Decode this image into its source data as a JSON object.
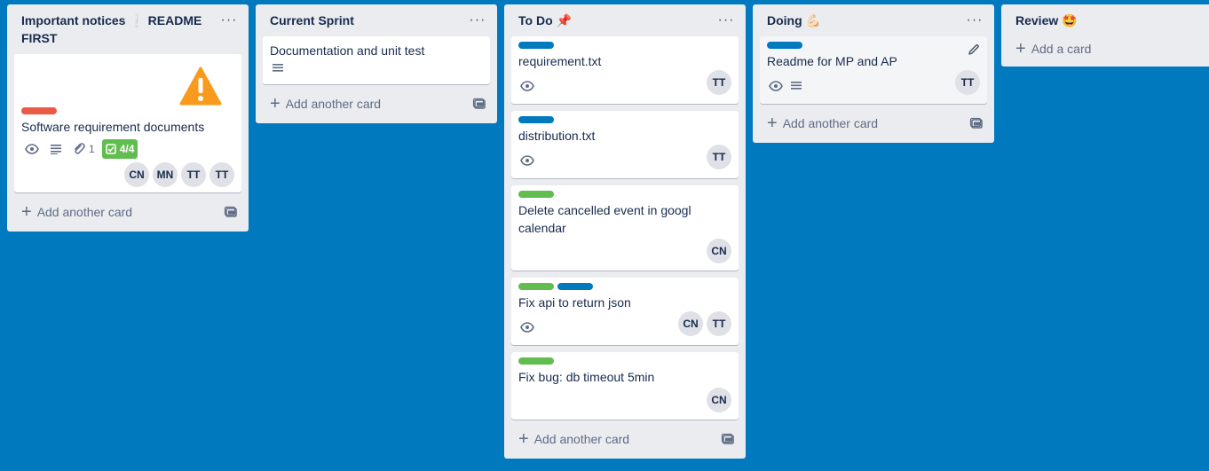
{
  "lists": [
    {
      "title": "Important notices ❕ README FIRST",
      "menu": "···",
      "add_label": "Add another card",
      "cards": [
        {
          "title": "Software requirement documents",
          "image_icon": "warning-icon",
          "labels": [
            "#eb5a46"
          ],
          "attachments": "1",
          "checklist": "4/4",
          "members": [
            "CN",
            "MN",
            "TT",
            "TT"
          ]
        }
      ]
    },
    {
      "title": "Current Sprint",
      "menu": "···",
      "add_label": "Add another card",
      "cards": [
        {
          "title": "Documentation and unit test",
          "labels": [],
          "members": []
        }
      ]
    },
    {
      "title": "To Do 📌",
      "menu": "···",
      "add_label": "Add another card",
      "cards": [
        {
          "title": "requirement.txt",
          "labels": [
            "#0079bf"
          ],
          "members": [
            "TT"
          ]
        },
        {
          "title": "distribution.txt",
          "labels": [
            "#0079bf"
          ],
          "members": [
            "TT"
          ]
        },
        {
          "title": "Delete cancelled event in googl calendar",
          "labels": [
            "#61bd4f"
          ],
          "members": [
            "CN"
          ]
        },
        {
          "title": "Fix api to return json",
          "labels": [
            "#61bd4f",
            "#0079bf"
          ],
          "members": [
            "CN",
            "TT"
          ]
        },
        {
          "title": "Fix bug: db timeout 5min",
          "labels": [
            "#61bd4f"
          ],
          "members": [
            "CN"
          ]
        }
      ]
    },
    {
      "title": "Doing 💪🏻",
      "menu": "···",
      "add_label": "Add another card",
      "cards": [
        {
          "title": "Readme for MP and AP",
          "labels": [
            "#0079bf"
          ],
          "members": [
            "TT"
          ]
        }
      ]
    },
    {
      "title": "Review 🤩",
      "add_label": "Add a card",
      "cards": []
    }
  ],
  "colors": {
    "board_bg": "#0079bf",
    "list_bg": "#ebecf0",
    "label_red": "#eb5a46",
    "label_blue": "#0079bf",
    "label_green": "#61bd4f"
  }
}
